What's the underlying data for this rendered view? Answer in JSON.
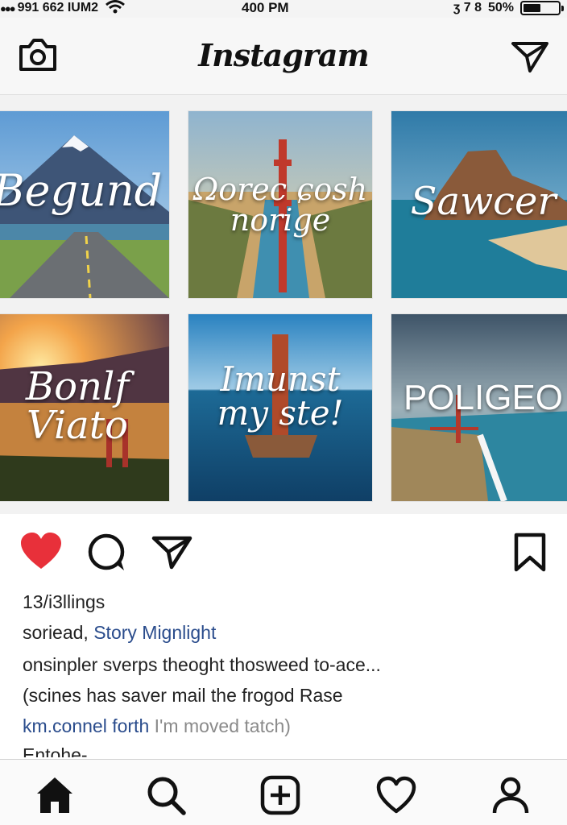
{
  "status_bar": {
    "signal": "●●●",
    "carrier": "991  662 IUM2",
    "time": "400 PM",
    "right_symbols": "ʒ   7  8",
    "battery": "50%",
    "battery_level": 0.5
  },
  "header": {
    "title": "Instagram",
    "camera_icon": "camera-icon",
    "direct_icon": "paper-plane-icon"
  },
  "grid": {
    "tiles": [
      {
        "caption": "Begund",
        "scene": "mountain road"
      },
      {
        "caption": "Ωorec ɕosh\nnorige",
        "scene": "golden gate bridge"
      },
      {
        "caption": "Sawcer",
        "scene": "sea cliffs"
      },
      {
        "caption": "Bonlf\nViato",
        "scene": "sunset coast"
      },
      {
        "caption": "Imunst\nmy ste!",
        "scene": "tower at sea"
      },
      {
        "caption": "POLIGEO",
        "scene": "coastline bridge"
      }
    ]
  },
  "actions": {
    "like_icon": "heart-filled-icon",
    "comment_icon": "comment-icon",
    "share_icon": "paper-plane-icon",
    "save_icon": "bookmark-icon"
  },
  "post": {
    "likes": "13/i3llings",
    "caption_user": "soriead,",
    "caption_link": "Story Mignlight",
    "line3": "onsinpler sverps theoght  thosweed to-ace...",
    "line4": "(scines  has saver mail the frogod Rase",
    "line5_link": "km.connel forth",
    "line5_muted": "I'm moved tatch)",
    "line6": "Entohe-"
  },
  "tabbar": {
    "items": [
      "home-icon",
      "search-icon",
      "add-post-icon",
      "activity-heart-icon",
      "profile-icon"
    ]
  },
  "colors": {
    "like": "#e8303a",
    "link": "#2a4c8c",
    "muted": "#8a8a8a"
  }
}
